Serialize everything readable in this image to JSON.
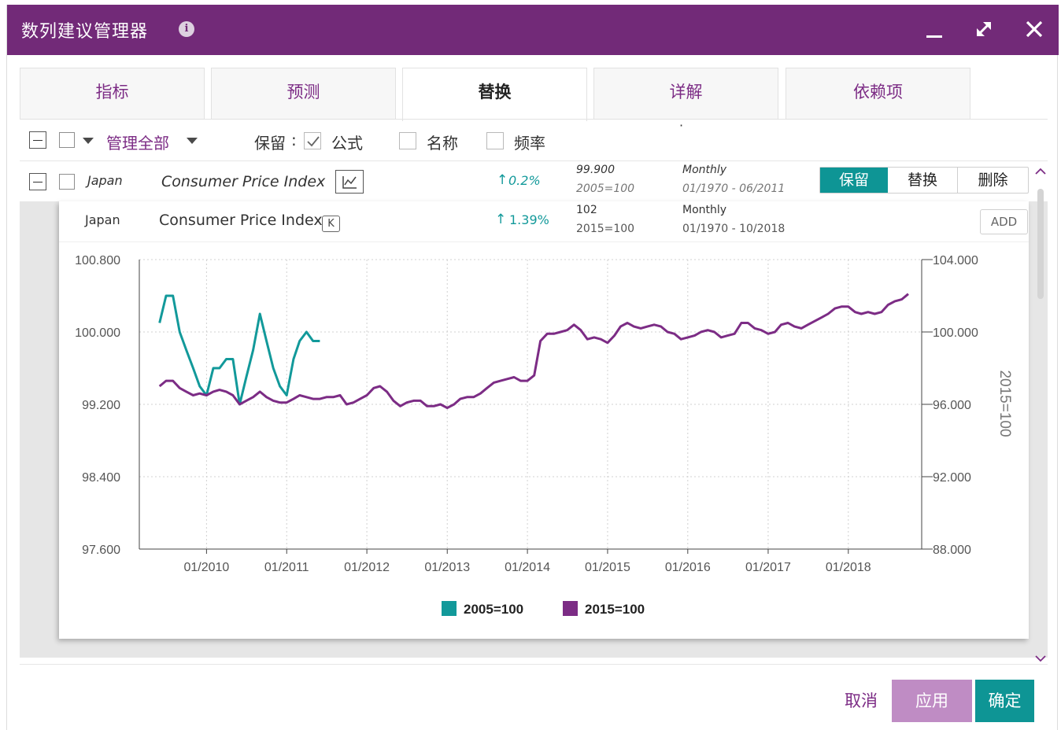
{
  "window": {
    "title": "数列建议管理器",
    "info_glyph": "i",
    "colors": {
      "titlebar": "#722a78",
      "accent": "#7c2c85",
      "teal": "#0e9595"
    }
  },
  "tabs": [
    {
      "label": "指标",
      "active": false
    },
    {
      "label": "预测",
      "active": false
    },
    {
      "label": "替换",
      "active": true
    },
    {
      "label": "详解",
      "active": false
    },
    {
      "label": "依赖项",
      "active": false
    }
  ],
  "toolbar": {
    "manage_all": "管理全部",
    "keep_label": "保留",
    "colon": ":",
    "formula_label": "公式",
    "formula_checked": true,
    "name_label": "名称",
    "frequency_label": "频率",
    "dot": "·"
  },
  "series_row": {
    "region": "Japan",
    "name": "Consumer Price Index",
    "change": "0.2%",
    "value": "99.900",
    "base": "2005=100",
    "frequency": "Monthly",
    "range": "01/1970 - 06/2011",
    "buttons": {
      "keep": "保留",
      "replace": "替换",
      "delete": "删除"
    }
  },
  "suggestion_row": {
    "region": "Japan",
    "name": "Consumer Price Index",
    "badge": "K",
    "change": "1.39%",
    "value": "102",
    "base": "2015=100",
    "frequency": "Monthly",
    "range": "01/1970 - 10/2018",
    "add_label": "ADD"
  },
  "chart_data": {
    "type": "line",
    "x_ticks": [
      "01/2010",
      "01/2011",
      "01/2012",
      "01/2013",
      "01/2014",
      "01/2015",
      "01/2016",
      "01/2017",
      "01/2018"
    ],
    "y_left": {
      "ticks": [
        "100.800",
        "100.000",
        "99.200",
        "98.400",
        "97.600"
      ],
      "range": [
        97.6,
        100.8
      ]
    },
    "y_right": {
      "ticks": [
        "104.000",
        "100.000",
        "96.000",
        "92.000",
        "88.000"
      ],
      "range": [
        88,
        104
      ],
      "label": "2015=100"
    },
    "grid": true,
    "legend_position": "bottom",
    "series": [
      {
        "name": "2005=100",
        "axis": "left",
        "color": "#12999a",
        "x": [
          "2009-06",
          "2009-07",
          "2009-08",
          "2009-09",
          "2009-10",
          "2009-11",
          "2009-12",
          "2010-01",
          "2010-02",
          "2010-03",
          "2010-04",
          "2010-05",
          "2010-06",
          "2010-07",
          "2010-08",
          "2010-09",
          "2010-10",
          "2010-11",
          "2010-12",
          "2011-01",
          "2011-02",
          "2011-03",
          "2011-04",
          "2011-05",
          "2011-06"
        ],
        "values": [
          100.1,
          100.4,
          100.4,
          100.0,
          99.8,
          99.6,
          99.4,
          99.3,
          99.6,
          99.6,
          99.7,
          99.7,
          99.2,
          99.5,
          99.8,
          100.2,
          99.9,
          99.6,
          99.4,
          99.3,
          99.7,
          99.9,
          100.0,
          99.9,
          99.9
        ]
      },
      {
        "name": "2015=100",
        "axis": "right",
        "color": "#7c2c85",
        "x": [
          "2009-06",
          "2009-07",
          "2009-08",
          "2009-09",
          "2009-10",
          "2009-11",
          "2009-12",
          "2010-01",
          "2010-02",
          "2010-03",
          "2010-04",
          "2010-05",
          "2010-06",
          "2010-07",
          "2010-08",
          "2010-09",
          "2010-10",
          "2010-11",
          "2010-12",
          "2011-01",
          "2011-02",
          "2011-03",
          "2011-04",
          "2011-05",
          "2011-06",
          "2011-07",
          "2011-08",
          "2011-09",
          "2011-10",
          "2011-11",
          "2011-12",
          "2012-01",
          "2012-02",
          "2012-03",
          "2012-04",
          "2012-05",
          "2012-06",
          "2012-07",
          "2012-08",
          "2012-09",
          "2012-10",
          "2012-11",
          "2012-12",
          "2013-01",
          "2013-02",
          "2013-03",
          "2013-04",
          "2013-05",
          "2013-06",
          "2013-07",
          "2013-08",
          "2013-09",
          "2013-10",
          "2013-11",
          "2013-12",
          "2014-01",
          "2014-02",
          "2014-03",
          "2014-04",
          "2014-05",
          "2014-06",
          "2014-07",
          "2014-08",
          "2014-09",
          "2014-10",
          "2014-11",
          "2014-12",
          "2015-01",
          "2015-02",
          "2015-03",
          "2015-04",
          "2015-05",
          "2015-06",
          "2015-07",
          "2015-08",
          "2015-09",
          "2015-10",
          "2015-11",
          "2015-12",
          "2016-01",
          "2016-02",
          "2016-03",
          "2016-04",
          "2016-05",
          "2016-06",
          "2016-07",
          "2016-08",
          "2016-09",
          "2016-10",
          "2016-11",
          "2016-12",
          "2017-01",
          "2017-02",
          "2017-03",
          "2017-04",
          "2017-05",
          "2017-06",
          "2017-07",
          "2017-08",
          "2017-09",
          "2017-10",
          "2017-11",
          "2017-12",
          "2018-01",
          "2018-02",
          "2018-03",
          "2018-04",
          "2018-05",
          "2018-06",
          "2018-07",
          "2018-08",
          "2018-09",
          "2018-10"
        ],
        "values": [
          97.0,
          97.3,
          97.3,
          96.9,
          96.7,
          96.5,
          96.6,
          96.5,
          96.7,
          96.8,
          96.7,
          96.5,
          96.0,
          96.2,
          96.4,
          96.7,
          96.4,
          96.2,
          96.1,
          96.1,
          96.3,
          96.5,
          96.4,
          96.3,
          96.3,
          96.4,
          96.4,
          96.5,
          96.0,
          96.1,
          96.3,
          96.5,
          96.9,
          97.0,
          96.7,
          96.2,
          95.9,
          96.1,
          96.2,
          96.2,
          95.9,
          95.9,
          96.0,
          95.8,
          96.0,
          96.3,
          96.4,
          96.4,
          96.6,
          96.9,
          97.2,
          97.3,
          97.4,
          97.5,
          97.3,
          97.3,
          97.6,
          99.5,
          99.9,
          99.9,
          100.0,
          100.1,
          100.4,
          100.1,
          99.6,
          99.7,
          99.6,
          99.4,
          99.8,
          100.3,
          100.5,
          100.3,
          100.2,
          100.3,
          100.4,
          100.3,
          100.0,
          99.9,
          99.6,
          99.7,
          99.8,
          100.0,
          100.1,
          100.0,
          99.7,
          99.8,
          99.9,
          100.5,
          100.5,
          100.2,
          100.1,
          99.9,
          100.0,
          100.4,
          100.5,
          100.3,
          100.2,
          100.4,
          100.6,
          100.8,
          101.0,
          101.3,
          101.4,
          101.4,
          101.1,
          101.0,
          101.1,
          101.0,
          101.1,
          101.5,
          101.7,
          101.8,
          102.1
        ]
      }
    ]
  },
  "footer": {
    "cancel": "取消",
    "apply": "应用",
    "ok": "确定"
  }
}
